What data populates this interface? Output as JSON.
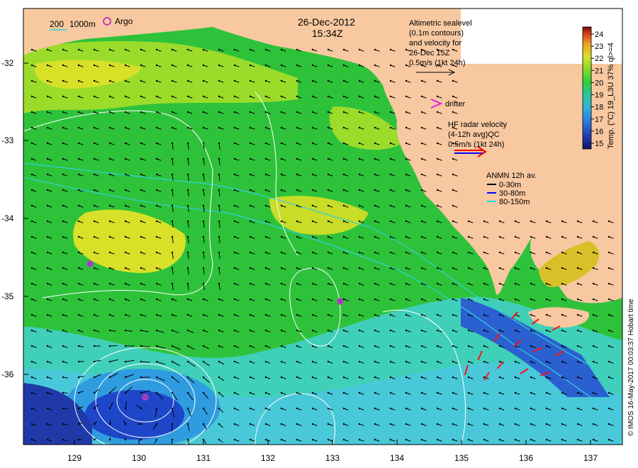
{
  "date": "26-Dec-2012",
  "time": "15:34Z",
  "scale": {
    "isobath_200": "200",
    "isobath_1000": "1000m"
  },
  "argo_label": "Argo",
  "altimetry": {
    "lines": [
      "Altimetric sealevel",
      "(0.1m contours)",
      "and velocity for",
      "26-Dec 15Z",
      "0.5m/s (1kt 24h)"
    ]
  },
  "drifter_label": "drifter",
  "hf_radar": {
    "lines": [
      "HF radar velocity",
      "(4-12h avg)QC",
      "0.5m/s (1kt 24h)"
    ]
  },
  "anmn": {
    "title": "ANMN 12h av.",
    "items": [
      {
        "label": "0-30m",
        "color": "#000000"
      },
      {
        "label": "30-80m",
        "color": "#0000ff"
      },
      {
        "label": "80-150m",
        "color": "#00e0e0"
      }
    ]
  },
  "colorbar": {
    "title": "Temp. (°C) 19_L3U 37% ql>=4",
    "ticks": [
      "15",
      "16",
      "17",
      "18",
      "19",
      "20",
      "21",
      "22",
      "23",
      "24"
    ],
    "colors": [
      "#1a1a6e",
      "#1f3aa8",
      "#2a78e0",
      "#2fb0d8",
      "#27c89a",
      "#2fcf3c",
      "#8adc2a",
      "#d8e02a",
      "#f0a020",
      "#d84018",
      "#8a1010"
    ]
  },
  "lat_ticks": [
    "-32",
    "-33",
    "-34",
    "-35",
    "-36"
  ],
  "lon_ticks": [
    "129",
    "130",
    "131",
    "132",
    "133",
    "134",
    "135",
    "136",
    "137"
  ],
  "credit": "© IMOS 16-May-2017 00:03:37 Hobart time",
  "colors": {
    "land": "#f8c8a0",
    "ocean_green": "#2ec23a",
    "ocean_cyan": "#3fcfc0",
    "ocean_blue": "#1e46c8",
    "yellow": "#d8e028"
  }
}
